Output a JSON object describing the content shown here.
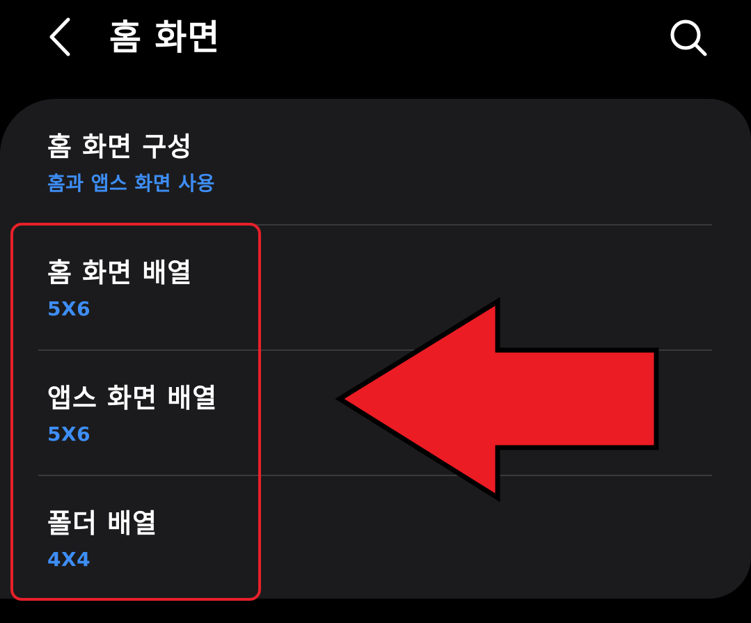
{
  "header": {
    "title": "홈 화면",
    "back_icon": "chevron-left-icon",
    "search_icon": "search-icon"
  },
  "settings": {
    "items": [
      {
        "title": "홈 화면 구성",
        "subtitle": "홈과 앱스 화면 사용"
      },
      {
        "title": "홈 화면 배열",
        "subtitle": "5X6"
      },
      {
        "title": "앱스 화면 배열",
        "subtitle": "5X6"
      },
      {
        "title": "폴더 배열",
        "subtitle": "4X4"
      }
    ]
  },
  "annotation": {
    "highlight_color": "#e8202a",
    "arrow_color": "#ec1c24",
    "arrow_direction": "left"
  },
  "colors": {
    "background": "#000000",
    "card": "#1b1b1d",
    "accent": "#3e8ef7",
    "text": "#ffffff"
  }
}
